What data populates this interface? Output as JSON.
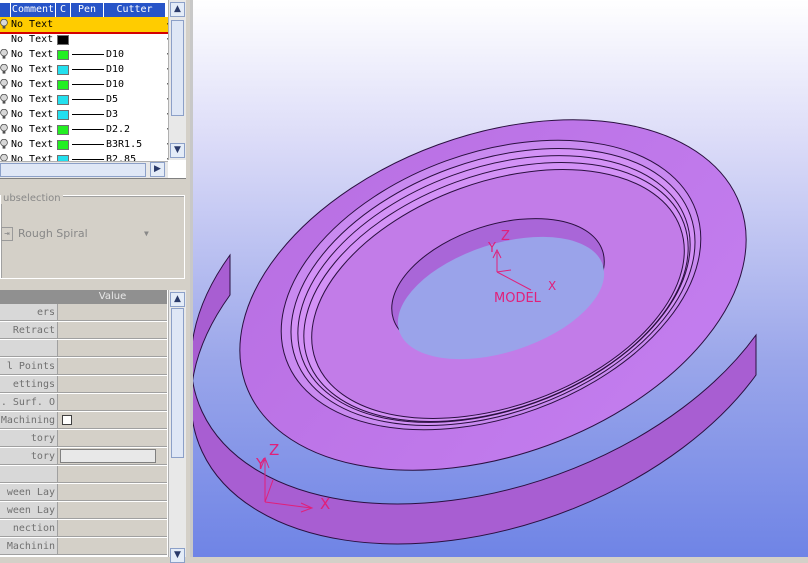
{
  "operations_list": {
    "columns": [
      "Comment",
      "C",
      "Pen",
      "Cutter"
    ],
    "rows": [
      {
        "comment": "No Text",
        "color": "#ffcc00",
        "pen": "",
        "cutter": "",
        "selected": true,
        "bulb": true
      },
      {
        "comment": "No Text",
        "color": "#000000",
        "pen": "",
        "cutter": "",
        "selected": false,
        "bulb": false
      },
      {
        "comment": "No Text",
        "color": "#22ee22",
        "pen": "line",
        "cutter": "D10",
        "selected": false,
        "bulb": true
      },
      {
        "comment": "No Text",
        "color": "#22e0ee",
        "pen": "line",
        "cutter": "D10",
        "selected": false,
        "bulb": true
      },
      {
        "comment": "No Text",
        "color": "#22ee22",
        "pen": "line",
        "cutter": "D10",
        "selected": false,
        "bulb": true
      },
      {
        "comment": "No Text",
        "color": "#22e0ee",
        "pen": "line",
        "cutter": "D5",
        "selected": false,
        "bulb": true
      },
      {
        "comment": "No Text",
        "color": "#22e0ee",
        "pen": "line",
        "cutter": "D3",
        "selected": false,
        "bulb": true
      },
      {
        "comment": "No Text",
        "color": "#22ee22",
        "pen": "line",
        "cutter": "D2.2",
        "selected": false,
        "bulb": true
      },
      {
        "comment": "No Text",
        "color": "#22ee22",
        "pen": "line",
        "cutter": "B3R1.5",
        "selected": false,
        "bulb": true
      },
      {
        "comment": "No Text",
        "color": "#22e0ee",
        "pen": "line",
        "cutter": "B2.85",
        "selected": false,
        "bulb": true
      }
    ]
  },
  "subselection": {
    "label": "ubselection",
    "value": "Rough Spiral"
  },
  "properties": {
    "value_header": "Value",
    "rows": [
      {
        "key": "ers",
        "checkbox": false,
        "field": false
      },
      {
        "key": "Retract",
        "checkbox": false,
        "field": false
      },
      {
        "key": "",
        "checkbox": false,
        "field": false
      },
      {
        "key": "l Points",
        "checkbox": false,
        "field": false
      },
      {
        "key": "ettings",
        "checkbox": false,
        "field": false
      },
      {
        "key": ". Surf. O",
        "checkbox": false,
        "field": false
      },
      {
        "key": "Machining",
        "checkbox": true,
        "field": false
      },
      {
        "key": "tory",
        "checkbox": false,
        "field": false
      },
      {
        "key": "tory",
        "checkbox": false,
        "field": true
      },
      {
        "key": "",
        "checkbox": false,
        "field": false
      },
      {
        "key": "ween Lay",
        "checkbox": false,
        "field": false
      },
      {
        "key": "ween Lay",
        "checkbox": false,
        "field": false
      },
      {
        "key": "nection",
        "checkbox": false,
        "field": false
      },
      {
        "key": "Machinin",
        "checkbox": false,
        "field": false
      }
    ]
  },
  "viewport": {
    "model_label": "MODEL",
    "axis_x": "X",
    "axis_y": "Y",
    "axis_z": "Z",
    "part_color": "#c07ae8",
    "axis_color": "#e0207a"
  }
}
